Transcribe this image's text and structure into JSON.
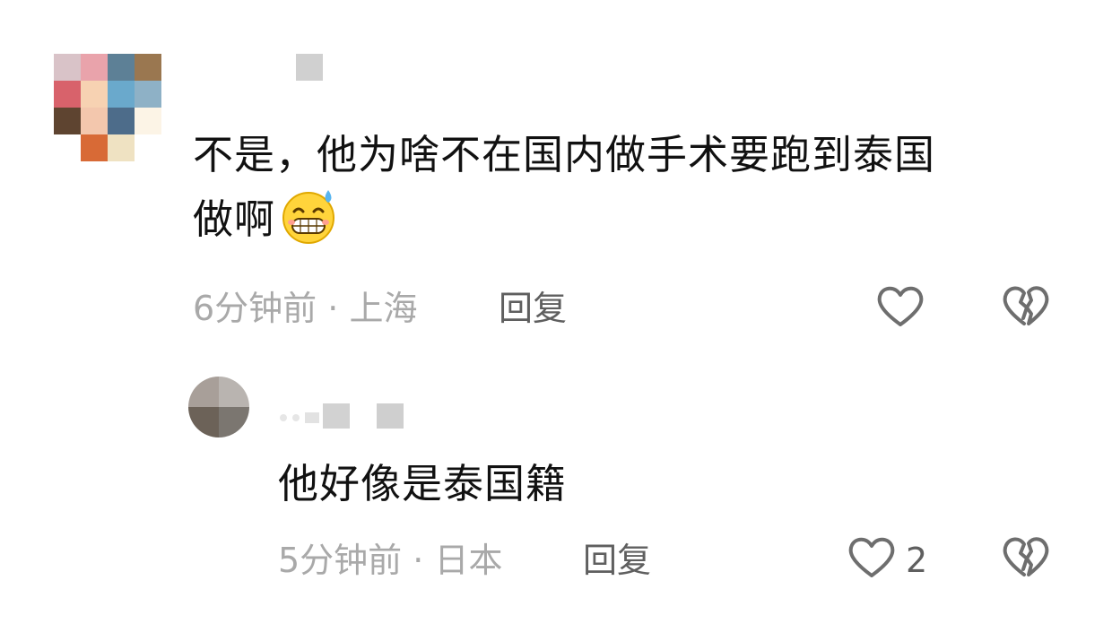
{
  "comments": [
    {
      "text_line1": "不是，他为啥不在国内做手术要跑到泰国",
      "text_line2": "做啊",
      "emoji": "sweat-grin-emoji",
      "time": "6分钟前",
      "separator": "·",
      "location": "上海",
      "reply_label": "回复",
      "like_icon": "heart-outline-icon",
      "dislike_icon": "broken-heart-icon"
    },
    {
      "text": "他好像是泰国籍",
      "time": "5分钟前",
      "separator": "·",
      "location": "日本",
      "reply_label": "回复",
      "like_icon": "heart-outline-icon",
      "like_count": "2",
      "dislike_icon": "broken-heart-icon"
    }
  ],
  "colors": {
    "background": "#ffffff",
    "text": "#111111",
    "meta": "#a9a9a9",
    "reply": "#5f5f5f",
    "icon": "#6e6e6e"
  }
}
